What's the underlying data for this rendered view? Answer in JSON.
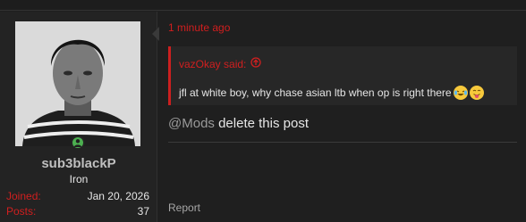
{
  "post": {
    "time": "1 minute ago",
    "quote": {
      "author_label": "vazOkay said:",
      "text": "jfl at white boy, why chase asian ltb when op is right there"
    },
    "message": {
      "mention": "@Mods",
      "text": " delete this post"
    },
    "report_label": "Report"
  },
  "user": {
    "username": "sub3blackP",
    "title": "Iron",
    "stats": [
      {
        "label": "Joined:",
        "value": "Jan 20, 2026"
      },
      {
        "label": "Posts:",
        "value": "37"
      }
    ]
  },
  "colors": {
    "accent": "#d11f1f",
    "online": "#4caf50",
    "background": "#1f1f1f"
  },
  "icons": [
    "user-online-icon",
    "quote-arrow-up-icon",
    "laughing-crying-emoji-icon",
    "tongue-out-emoji-icon"
  ]
}
